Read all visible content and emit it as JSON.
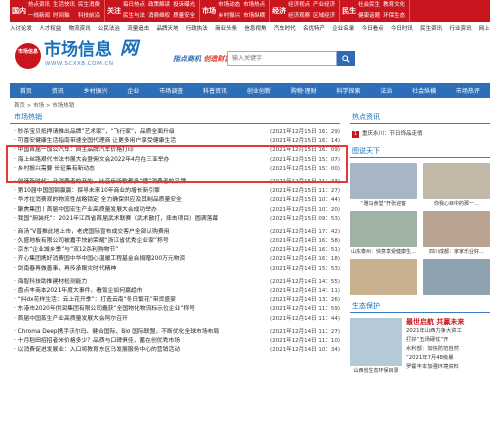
{
  "topnav": [
    {
      "head": "国内",
      "items": [
        "热点资讯",
        "一线新闻",
        "生活快讯",
        "时间轴",
        "民生消费",
        "科技前沿"
      ]
    },
    {
      "head": "关注",
      "items": [
        "每日热点",
        "民生与法",
        "政策解读",
        "消费维权",
        "投诉曝光",
        "质量安全"
      ]
    },
    {
      "head": "市场",
      "items": [
        "市场动态",
        "乡村振兴",
        "市场热点",
        "市场纵横"
      ]
    },
    {
      "head": "经济",
      "items": [
        "经济视点",
        "经济观察",
        "产业经济",
        "区域经济"
      ]
    },
    {
      "head": "民生",
      "items": [
        "社会民生",
        "健康话题",
        "教育文化",
        "环保生态"
      ]
    }
  ],
  "subnav": [
    "入讨论发",
    "人才权益",
    "物流资讯",
    "公民法治",
    "流量追击",
    "品牌天地",
    "行政执法",
    "商业头条",
    "信息视角",
    "汽车时代",
    "名优特产",
    "企业名录",
    "今日看点",
    "今日时讯",
    "民生资讯",
    "行业资讯",
    "网上"
  ],
  "header": {
    "seal_text": "市场信息",
    "logo_text": "市场信息",
    "logo_mark": "网",
    "url": "WWW.SCXXB.COM.CN",
    "slogan": [
      "指点商机",
      "创造财富",
      "指点"
    ],
    "search_placeholder": "输入关键字"
  },
  "channels": [
    "首页",
    "资讯",
    "乡村振兴",
    "企业",
    "市场调查",
    "科普资讯",
    "创业创新",
    "购物·理财",
    "科学探索",
    "法治",
    "社会纵横",
    "市场热评"
  ],
  "breadcrumb": "首页 > 市场 > 市场热销",
  "main": {
    "section_title": "市场热销",
    "groups": [
      [
        {
          "title": "· 秒杀宝贝抵押请推出品牌”艺术家”，“飞行家”，品质全面升级",
          "date": "(2021年12月15日 16：29)"
        },
        {
          "title": "· 可喜安健康生活指南带速全国代理商 让更多用户享受健康生活",
          "date": "(2021年12月15日 16：14)"
        },
        {
          "title": "· 中国首届一加公汽车：自主品牌汽车价格打印",
          "date": "(2021年12月15日 16：09)"
        },
        {
          "title": "· 海上丝路艰代书法书展大会暨佣文会2022年4月在三亚举办",
          "date": "(2021年12月15日 15：07)"
        },
        {
          "title": "· 乡村振兴需要 长征集有新动态",
          "date": "(2021年12月15日 15：00)"
        }
      ],
      [
        {
          "title": "· 创造新时代：马消费者的开始，比音乐听歌都多“懂”消费者的品牌",
          "date": "(2021年12月15日 11：43)"
        },
        {
          "title": "· 第10届中国国钢赢赢：探寻未来10年商业的增长新引擎",
          "date": "(2021年12月15日 11：27)"
        },
        {
          "title": "· 华才拉消费观的物流性战略锁定 全力确保供应及其制品质量安全",
          "date": "(2021年12月15日 10：44)"
        },
        {
          "title": "· 聚焦集团丨首届中国宏生产业高质量发展大会成功举办",
          "date": "(2021年12月15日 10：20)"
        },
        {
          "title": "· 我国“厨装托”：2021年江西省首届武术联赛（武术散打，摔击项目）圆满落幕",
          "date": "(2021年12月15日 09：53)"
        }
      ],
      [
        {
          "title": "· 商汤“V普推此地上市，老虎国际宣布成交客户全部认购费用",
          "date": "(2021年12月14日 17：42)"
        },
        {
          "title": "· 久盛地板有限公司被嘉手快前荣耀“浙江省优秀企业家”称号",
          "date": "(2021年12月14日 16：58)"
        },
        {
          "title": "· 京东“企业城乡季”与“双12杀利购物节”",
          "date": "(2021年12月14日 16：51)"
        },
        {
          "title": "· 齐心集团携好消费国中华中国心温暖工程基金会捐赠200万元物资",
          "date": "(2021年12月14日 16：18)"
        },
        {
          "title": "· 剑南春再做善事，再传承赈灾时代精神",
          "date": "(2021年12月14日 15：53)"
        }
      ],
      [
        {
          "title": "· 海智科技助推建材检测能力",
          "date": "(2021年12月14日 14：55)"
        },
        {
          "title": "· 盘点丰商本2021年度大事件，看饭企如何赢趋市",
          "date": "(2021年12月14日 14：11)"
        },
        {
          "title": "· “抖dx花样生活：云上花开季”：打造云南“冬日繁花”带货盛宴",
          "date": "(2021年12月14日 13：26)"
        },
        {
          "title": "· 东港市2020年供润集团有限公司蠢获“全国物化物流标示位企业”称号",
          "date": "(2021年12月14日 11：59)"
        },
        {
          "title": "· 首届中国蒸生产业高质量发展大会阿尔召开",
          "date": "(2021年12月14日 11：44)"
        }
      ],
      [
        {
          "title": "· Chroma Deep携手沃尔玛、健合国际、Bio 国际联盟，不断优化全球市场布局",
          "date": "(2021年12月14日 11：27)"
        },
        {
          "title": "· 十月稻田招招者米价格多少？品质与口碑俱佳，蓄在创优秀市场",
          "date": "(2021年12月14日 11：10)"
        },
        {
          "title": "· 以消费促进发展业：入口将教育东区马发展服务中心的营销活动",
          "date": "(2021年12月14日 10：34)"
        }
      ]
    ]
  },
  "right": {
    "hot_title": "热点资讯",
    "hot_item": {
      "num": "1",
      "text": "重庆永川：节日饰品走俏"
    },
    "pic_title": "图说天下",
    "pics": [
      {
        "cap": "“雅马食堂”开张迎客",
        "color": "#a7b6c4"
      },
      {
        "cap": "你我心目中的那一…",
        "color": "#c2b8a7"
      },
      {
        "cap": "山东泰州：快意享受健康生…",
        "color": "#9fb2a3"
      },
      {
        "cap": "四川成都：家家乐业好…",
        "color": "#b9a393"
      },
      {
        "cap": "",
        "color": "#c9b08f"
      },
      {
        "cap": "",
        "color": "#8fa2b0"
      }
    ],
    "eco_title": "生态保护",
    "eco": {
      "head": "最世启航 共赢未来",
      "lines": [
        "2021年山西力争大资工",
        "打好“五场硬仗”开",
        "水利部：加快防范自然",
        "“2021年7月48级暴",
        "罗霍丰本加强环境资料"
      ],
      "cap": "山西省生态环保目录"
    }
  }
}
